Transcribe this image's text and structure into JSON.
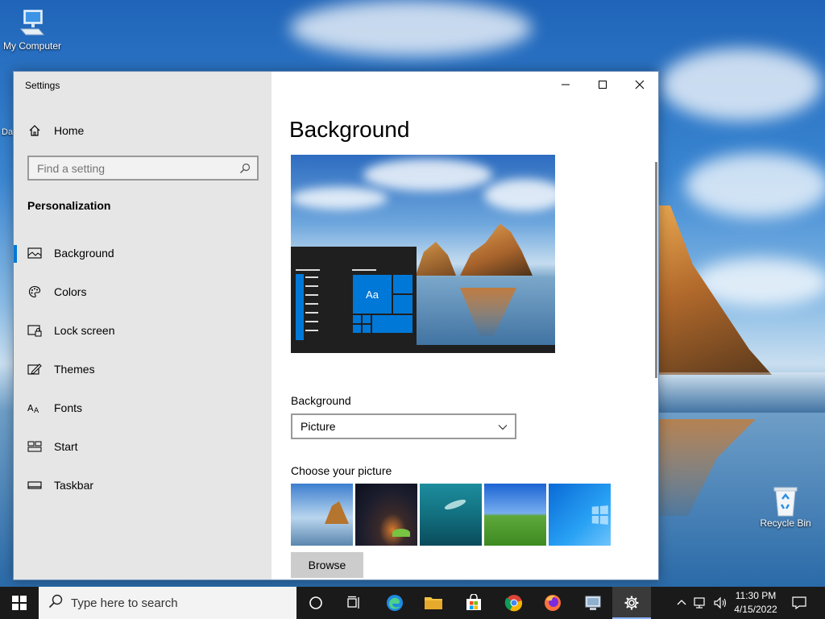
{
  "desktop": {
    "icons": [
      {
        "label": "My Computer"
      },
      {
        "label": "Recycle Bin"
      }
    ],
    "partial_label": "Da"
  },
  "window": {
    "title": "Settings",
    "controls": {
      "minimize": "minimize-icon",
      "maximize": "maximize-icon",
      "close": "close-icon"
    }
  },
  "sidebar": {
    "home_label": "Home",
    "search_placeholder": "Find a setting",
    "section_title": "Personalization",
    "items": [
      {
        "label": "Background",
        "icon": "picture-icon",
        "active": true
      },
      {
        "label": "Colors",
        "icon": "palette-icon",
        "active": false
      },
      {
        "label": "Lock screen",
        "icon": "lock-screen-icon",
        "active": false
      },
      {
        "label": "Themes",
        "icon": "themes-icon",
        "active": false
      },
      {
        "label": "Fonts",
        "icon": "fonts-icon",
        "active": false
      },
      {
        "label": "Start",
        "icon": "start-icon",
        "active": false
      },
      {
        "label": "Taskbar",
        "icon": "taskbar-icon",
        "active": false
      }
    ]
  },
  "main": {
    "page_title": "Background",
    "preview_tile_text": "Aa",
    "background_label": "Background",
    "background_value": "Picture",
    "choose_label": "Choose your picture",
    "browse_label": "Browse"
  },
  "taskbar": {
    "search_placeholder": "Type here to search",
    "time": "11:30 PM",
    "date": "4/15/2022",
    "accent": "#0078d7"
  }
}
